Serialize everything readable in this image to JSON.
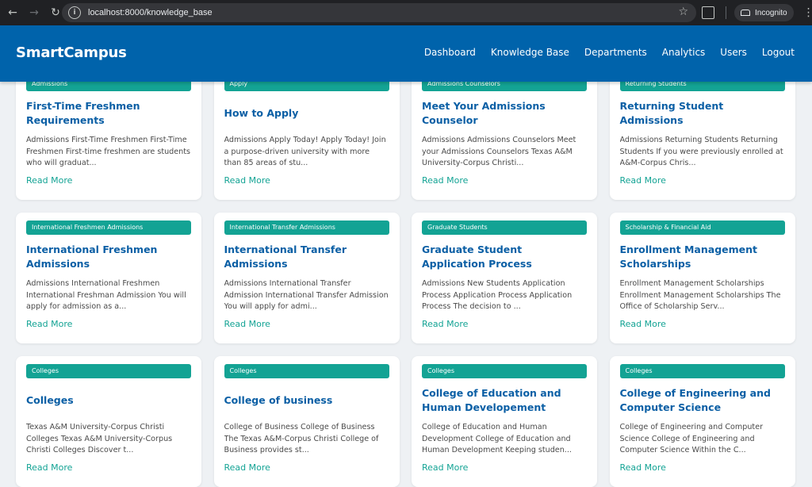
{
  "browser": {
    "url": "localhost:8000/knowledge_base",
    "incognito_label": "Incognito"
  },
  "header": {
    "brand": "SmartCampus",
    "nav": [
      {
        "label": "Dashboard"
      },
      {
        "label": "Knowledge Base"
      },
      {
        "label": "Departments"
      },
      {
        "label": "Analytics"
      },
      {
        "label": "Users"
      },
      {
        "label": "Logout"
      }
    ]
  },
  "articles": [
    {
      "tag": "Admissions",
      "title": "First-Time Freshmen Requirements",
      "summary": "Admissions First-Time Freshmen First-Time Freshmen First-time freshmen are students who will graduat...",
      "link": "Read More"
    },
    {
      "tag": "Apply",
      "title": "How to Apply",
      "summary": "Admissions Apply Today! Apply Today! Join a purpose-driven university with more than 85 areas of stu...",
      "link": "Read More"
    },
    {
      "tag": "Admissions Counselors",
      "title": "Meet Your Admissions Counselor",
      "summary": "Admissions Admissions Counselors Meet your Admissions Counselors Texas A&M University-Corpus Christi...",
      "link": "Read More"
    },
    {
      "tag": "Returning Students",
      "title": "Returning Student Admissions",
      "summary": "Admissions Returning Students Returning Students If you were previously enrolled at A&M-Corpus Chris...",
      "link": "Read More"
    },
    {
      "tag": "International Freshmen Admissions",
      "title": "International Freshmen Admissions",
      "summary": "Admissions International Freshmen International Freshman Admission You will apply for admission as a...",
      "link": "Read More"
    },
    {
      "tag": "International Transfer Admissions",
      "title": "International Transfer Admissions",
      "summary": "Admissions International Transfer Admission International Transfer Admission You will apply for admi...",
      "link": "Read More"
    },
    {
      "tag": "Graduate Students",
      "title": "Graduate Student Application Process",
      "summary": "Admissions New Students Application Process Application Process Application Process The decision to ...",
      "link": "Read More"
    },
    {
      "tag": "Scholarship & Financial Aid",
      "title": "Enrollment Management Scholarships",
      "summary": "Enrollment Management Scholarships Enrollment Management Scholarships The Office of Scholarship Serv...",
      "link": "Read More"
    },
    {
      "tag": "Colleges",
      "title": "Colleges",
      "summary": "Texas A&M University-Corpus Christi Colleges Texas A&M University-Corpus Christi Colleges Discover t...",
      "link": "Read More"
    },
    {
      "tag": "Colleges",
      "title": "College of business",
      "summary": "College of Business College of Business The Texas A&M-Corpus Christi College of Business provides st...",
      "link": "Read More"
    },
    {
      "tag": "Colleges",
      "title": "College of Education and Human Developement",
      "summary": "College of Education and Human Development College of Education and Human Development Keeping studen...",
      "link": "Read More"
    },
    {
      "tag": "Colleges",
      "title": "College of Engineering and Computer Science",
      "summary": "College of Engineering and Computer Science College of Engineering and Computer Science Within the C...",
      "link": "Read More"
    }
  ]
}
